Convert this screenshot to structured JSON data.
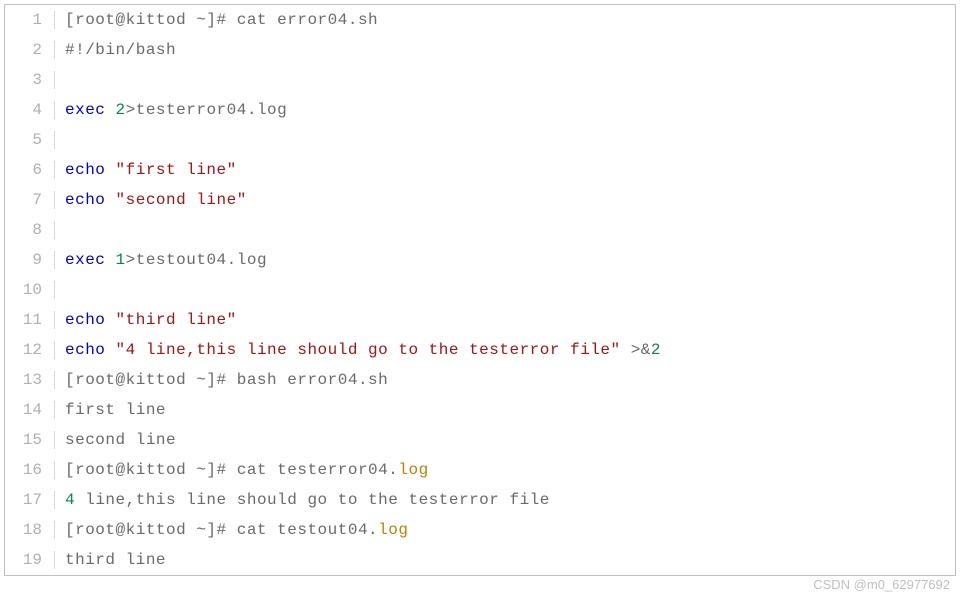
{
  "colors": {
    "default": "#6a6a6a",
    "keyword": "#0000d0",
    "string": "#a31515",
    "path": "#c08000",
    "number": "#098658"
  },
  "watermark": "CSDN @m0_62977692",
  "lines": [
    {
      "num": "1",
      "tokens": [
        {
          "t": "[root@kittod ~]# cat error04.sh",
          "c": "default"
        }
      ]
    },
    {
      "num": "2",
      "tokens": [
        {
          "t": "#!/bin/bash",
          "c": "default"
        }
      ]
    },
    {
      "num": "3",
      "tokens": []
    },
    {
      "num": "4",
      "tokens": [
        {
          "t": "exec",
          "c": "keyword"
        },
        {
          "t": " ",
          "c": "default"
        },
        {
          "t": "2",
          "c": "number"
        },
        {
          "t": ">testerror04.log",
          "c": "default"
        }
      ]
    },
    {
      "num": "5",
      "tokens": []
    },
    {
      "num": "6",
      "tokens": [
        {
          "t": "echo",
          "c": "keyword"
        },
        {
          "t": " ",
          "c": "default"
        },
        {
          "t": "\"first line\"",
          "c": "string"
        }
      ]
    },
    {
      "num": "7",
      "tokens": [
        {
          "t": "echo",
          "c": "keyword"
        },
        {
          "t": " ",
          "c": "default"
        },
        {
          "t": "\"second line\"",
          "c": "string"
        }
      ]
    },
    {
      "num": "8",
      "tokens": []
    },
    {
      "num": "9",
      "tokens": [
        {
          "t": "exec",
          "c": "keyword"
        },
        {
          "t": " ",
          "c": "default"
        },
        {
          "t": "1",
          "c": "number"
        },
        {
          "t": ">testout04.log",
          "c": "default"
        }
      ]
    },
    {
      "num": "10",
      "tokens": []
    },
    {
      "num": "11",
      "tokens": [
        {
          "t": "echo",
          "c": "keyword"
        },
        {
          "t": " ",
          "c": "default"
        },
        {
          "t": "\"third line\"",
          "c": "string"
        }
      ]
    },
    {
      "num": "12",
      "tokens": [
        {
          "t": "echo",
          "c": "keyword"
        },
        {
          "t": " ",
          "c": "default"
        },
        {
          "t": "\"4 line,this line should go to the testerror file\"",
          "c": "string"
        },
        {
          "t": " >&",
          "c": "default"
        },
        {
          "t": "2",
          "c": "number"
        }
      ]
    },
    {
      "num": "13",
      "tokens": [
        {
          "t": "[root@kittod ~]# bash error04.sh",
          "c": "default"
        }
      ]
    },
    {
      "num": "14",
      "tokens": [
        {
          "t": "first line",
          "c": "default"
        }
      ]
    },
    {
      "num": "15",
      "tokens": [
        {
          "t": "second line",
          "c": "default"
        }
      ]
    },
    {
      "num": "16",
      "tokens": [
        {
          "t": "[root@kittod ~]# cat testerror04.",
          "c": "default"
        },
        {
          "t": "log",
          "c": "path"
        }
      ]
    },
    {
      "num": "17",
      "tokens": [
        {
          "t": "4",
          "c": "number"
        },
        {
          "t": " line,this line should go to the testerror file",
          "c": "default"
        }
      ]
    },
    {
      "num": "18",
      "tokens": [
        {
          "t": "[root@kittod ~]# cat testout04.",
          "c": "default"
        },
        {
          "t": "log",
          "c": "path"
        }
      ]
    },
    {
      "num": "19",
      "tokens": [
        {
          "t": "third line",
          "c": "default"
        }
      ]
    }
  ]
}
